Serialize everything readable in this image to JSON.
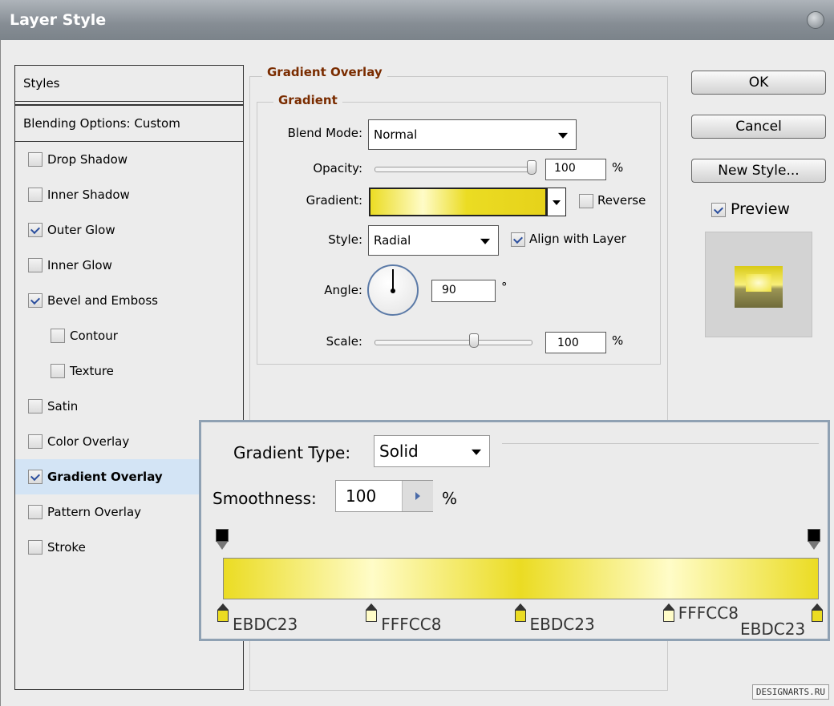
{
  "window": {
    "title": "Layer Style"
  },
  "styles_panel": {
    "header": "Styles",
    "blending": "Blending Options: Custom",
    "items": [
      {
        "label": "Drop Shadow",
        "checked": false
      },
      {
        "label": "Inner Shadow",
        "checked": false
      },
      {
        "label": "Outer Glow",
        "checked": true
      },
      {
        "label": "Inner Glow",
        "checked": false
      },
      {
        "label": "Bevel and Emboss",
        "checked": true
      },
      {
        "label": "Contour",
        "checked": false
      },
      {
        "label": "Texture",
        "checked": false
      },
      {
        "label": "Satin",
        "checked": false
      },
      {
        "label": "Color Overlay",
        "checked": false
      },
      {
        "label": "Gradient Overlay",
        "checked": true
      },
      {
        "label": "Pattern Overlay",
        "checked": false
      },
      {
        "label": "Stroke",
        "checked": false
      }
    ]
  },
  "gradient_overlay": {
    "section_title": "Gradient Overlay",
    "group_title": "Gradient",
    "blend_mode_label": "Blend Mode:",
    "blend_mode_value": "Normal",
    "opacity_label": "Opacity:",
    "opacity_value": "100",
    "opacity_unit": "%",
    "opacity_level": 1.0,
    "gradient_label": "Gradient:",
    "reverse_label": "Reverse",
    "reverse_checked": false,
    "style_label": "Style:",
    "style_value": "Radial",
    "align_label": "Align with Layer",
    "align_checked": true,
    "angle_label": "Angle:",
    "angle_value": "90",
    "angle_unit": "°",
    "scale_label": "Scale:",
    "scale_value": "100",
    "scale_unit": "%"
  },
  "buttons": {
    "ok": "OK",
    "cancel": "Cancel",
    "new_style": "New Style...",
    "preview_label": "Preview",
    "preview_checked": true
  },
  "gradient_editor": {
    "type_label": "Gradient Type:",
    "type_value": "Solid",
    "smoothness_label": "Smoothness:",
    "smoothness_value": "100",
    "smoothness_unit": "%",
    "stops": [
      {
        "label": "EBDC23",
        "color": "#EBDC23",
        "location": 0.0
      },
      {
        "label": "FFFCC8",
        "color": "#FFFCC8",
        "location": 0.25
      },
      {
        "label": "EBDC23",
        "color": "#EBDC23",
        "location": 0.5
      },
      {
        "label": "FFFCC8",
        "color": "#FFFCC8",
        "location": 0.75
      },
      {
        "label": "EBDC23",
        "color": "#EBDC23",
        "location": 1.0
      }
    ]
  },
  "watermark": "DESIGNARTS.RU",
  "colors": {
    "accent": "#7a2c00",
    "selection": "#d3e4f5",
    "gradient_dark": "#EBDC23",
    "gradient_light": "#FFFCC8"
  }
}
